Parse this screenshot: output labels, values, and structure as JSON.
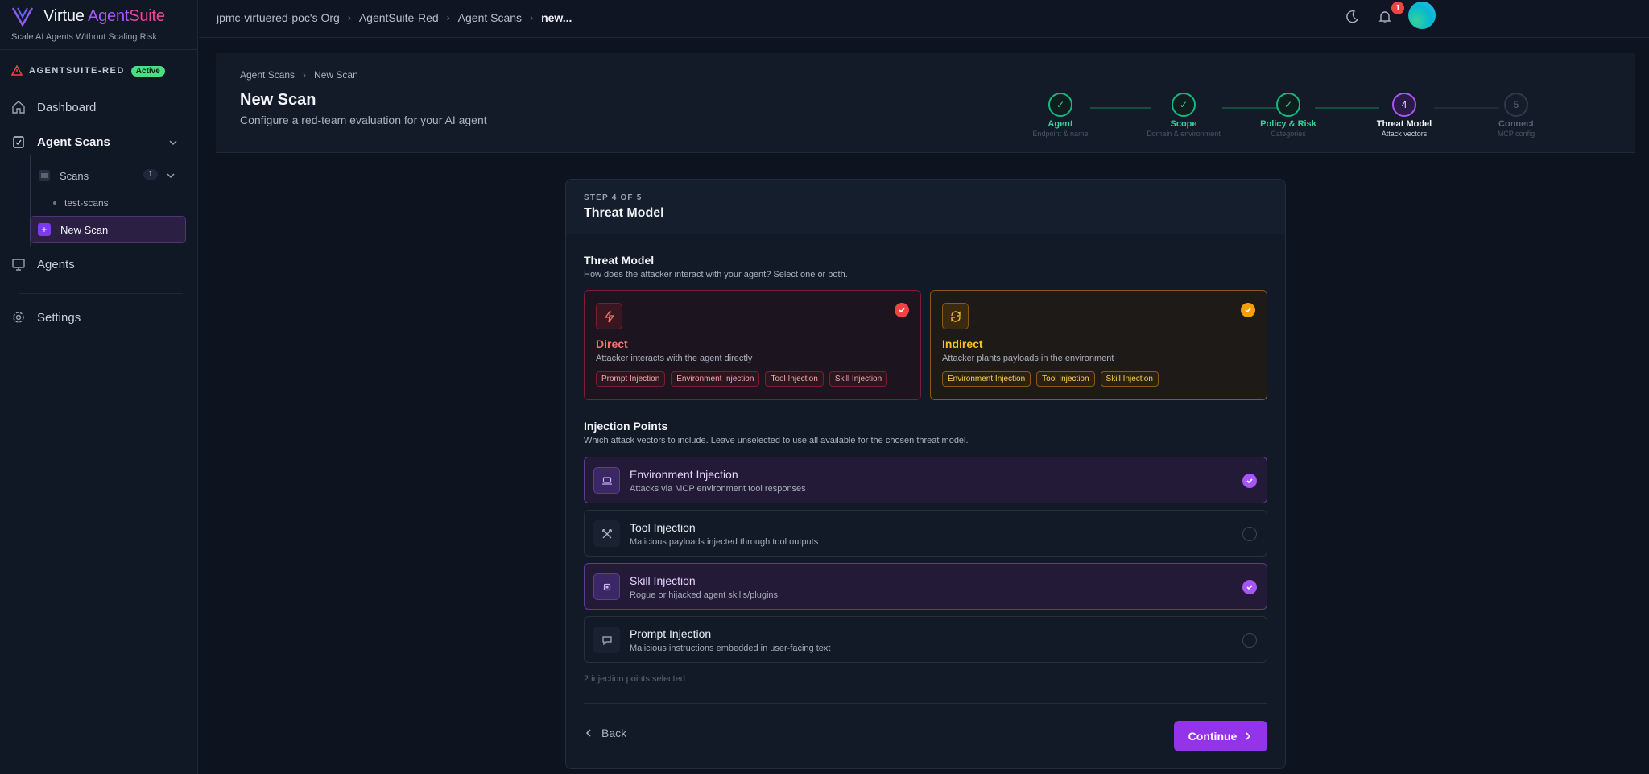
{
  "brand": {
    "name_a": "Virtue ",
    "name_b": "Agent",
    "name_c": "Suite",
    "tagline": "Scale AI Agents Without Scaling Risk"
  },
  "org": {
    "name": "AGENTSUITE-RED",
    "status": "Active"
  },
  "sidebar": {
    "dashboard": "Dashboard",
    "agent_scans": "Agent Scans",
    "scans": "Scans",
    "scans_count": "1",
    "test_scans": "test-scans",
    "new_scan": "New Scan",
    "agents": "Agents",
    "settings": "Settings"
  },
  "topbar": {
    "crumbs": [
      "jpmc-virtuered-poc's Org",
      "AgentSuite-Red",
      "Agent Scans",
      "new..."
    ],
    "notifications": "1"
  },
  "header": {
    "crumbs": [
      "Agent Scans",
      "New Scan"
    ],
    "title": "New Scan",
    "subtitle": "Configure a red-team evaluation for your AI agent"
  },
  "steps": [
    {
      "num": "1",
      "title": "Agent",
      "sub": "Endpoint & name",
      "state": "done"
    },
    {
      "num": "2",
      "title": "Scope",
      "sub": "Domain & environment",
      "state": "done"
    },
    {
      "num": "3",
      "title": "Policy & Risk",
      "sub": "Categories",
      "state": "done"
    },
    {
      "num": "4",
      "title": "Threat Model",
      "sub": "Attack vectors",
      "state": "current"
    },
    {
      "num": "5",
      "title": "Connect",
      "sub": "MCP config",
      "state": "todo"
    }
  ],
  "card": {
    "step_label": "STEP 4 OF 5",
    "title": "Threat Model",
    "threat_title": "Threat Model",
    "threat_sub": "How does the attacker interact with your agent? Select one or both.",
    "direct": {
      "name": "Direct",
      "desc": "Attacker interacts with the agent directly",
      "chips": [
        "Prompt Injection",
        "Environment Injection",
        "Tool Injection",
        "Skill Injection"
      ]
    },
    "indirect": {
      "name": "Indirect",
      "desc": "Attacker plants payloads in the environment",
      "chips": [
        "Environment Injection",
        "Tool Injection",
        "Skill Injection"
      ]
    },
    "ip_title": "Injection Points",
    "ip_sub": "Which attack vectors to include. Leave unselected to use all available for the chosen threat model.",
    "injection_points": [
      {
        "name": "Environment Injection",
        "desc": "Attacks via MCP environment tool responses",
        "selected": true
      },
      {
        "name": "Tool Injection",
        "desc": "Malicious payloads injected through tool outputs",
        "selected": false
      },
      {
        "name": "Skill Injection",
        "desc": "Rogue or hijacked agent skills/plugins",
        "selected": true
      },
      {
        "name": "Prompt Injection",
        "desc": "Malicious instructions embedded in user-facing text",
        "selected": false
      }
    ],
    "selected_count": "2 injection points selected",
    "back": "Back",
    "continue": "Continue"
  },
  "colors": {
    "accent": "#9333ea",
    "done": "#10b981",
    "direct": "#ef4444",
    "indirect": "#f59e0b"
  }
}
